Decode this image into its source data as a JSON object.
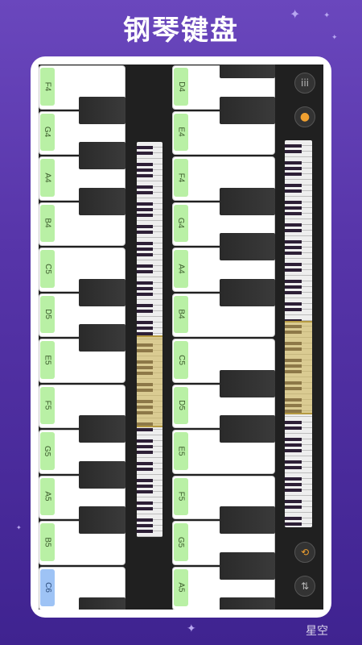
{
  "promo": {
    "title": "钢琴键盘"
  },
  "left_panel": {
    "notes": [
      "F4",
      "G4",
      "A4",
      "B4",
      "C5",
      "D5",
      "E5",
      "F5",
      "G5",
      "A5",
      "B5",
      "C6"
    ],
    "active_note": "C6"
  },
  "right_panel": {
    "notes": [
      "D4",
      "E4",
      "F4",
      "G4",
      "A4",
      "B4",
      "C5",
      "D5",
      "E5",
      "F5",
      "G5",
      "A5"
    ]
  },
  "controls": {
    "menu_icon": "iii",
    "record_icon": "●",
    "loop_icon": "⟲",
    "swap_icon": "⇅"
  },
  "accent_colors": {
    "note_tag": "#b9f0a5",
    "active_tag": "#9ec3f5",
    "highlight": "#cdb455",
    "record": "#f0a030"
  },
  "watermark": {
    "text": "星空"
  }
}
